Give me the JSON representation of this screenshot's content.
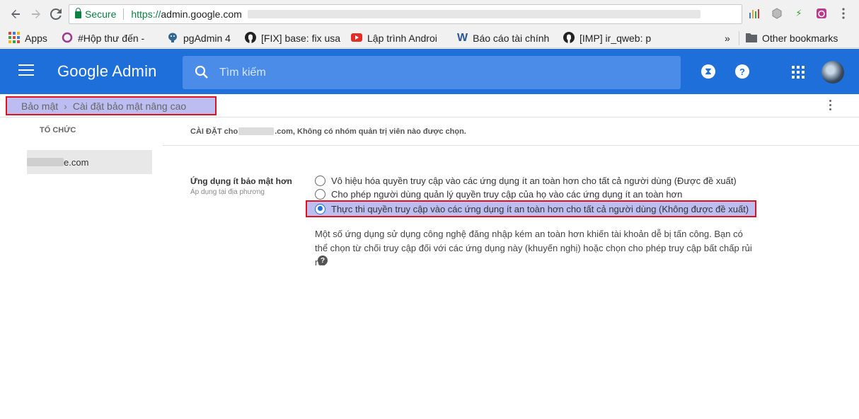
{
  "browser": {
    "secure_label": "Secure",
    "url_scheme": "https://",
    "url_host": "admin.google.com",
    "bookmarks": [
      {
        "label": "Apps",
        "icon": "apps-grid-icon"
      },
      {
        "label": "#Hộp thư đến - ",
        "icon": "inbox-icon"
      },
      {
        "label": "pgAdmin 4",
        "icon": "pgadmin-icon"
      },
      {
        "label": "[FIX] base: fix usa",
        "icon": "github-icon"
      },
      {
        "label": "Lập trình Androi",
        "icon": "youtube-icon"
      },
      {
        "label": "Báo cáo tài chính",
        "icon": "word-icon"
      },
      {
        "label": "[IMP] ir_qweb: p",
        "icon": "github-icon"
      }
    ],
    "overflow_label": "»",
    "other_bookmarks": "Other bookmarks"
  },
  "header": {
    "brand": "Google Admin",
    "search_placeholder": "Tìm kiếm"
  },
  "breadcrumb": {
    "parent": "Bảo mật",
    "separator": "›",
    "current": "Cài đặt bảo mật nâng cao"
  },
  "sidebar": {
    "title": "TỔ CHỨC",
    "org_suffix": "e.com"
  },
  "settings_header": {
    "prefix": "CÀI ĐẶT cho",
    "suffix": ".com, Không có nhóm quản trị viên nào được chọn."
  },
  "setting": {
    "title": "Ứng dụng ít bảo mật hơn",
    "subtitle": "Áp dụng tại địa phương",
    "options": [
      {
        "label": "Vô hiệu hóa quyền truy cập vào các ứng dụng ít an toàn hơn cho tất cả người dùng (Được đề xuất)",
        "selected": false
      },
      {
        "label": "Cho phép người dùng quản lý quyền truy cập của họ vào các ứng dụng ít an toàn hơn",
        "selected": false
      },
      {
        "label": "Thực thi quyền truy cập vào các ứng dụng ít an toàn hơn cho tất cả người dùng (Không được đề xuất)",
        "selected": true
      }
    ],
    "description": "Một số ứng dụng sử dụng công nghệ đăng nhập kém an toàn hơn khiến tài khoản dễ bị tấn công. Bạn có thể chọn từ chối truy cập đối với các ứng dụng này (khuyến nghị) hoặc chọn cho phép truy cập bất chấp rủi ro.",
    "help_symbol": "?"
  },
  "colors": {
    "primary": "#1e6fd9",
    "highlight": "#bdbdf1",
    "annotation_border": "#e0121e"
  }
}
